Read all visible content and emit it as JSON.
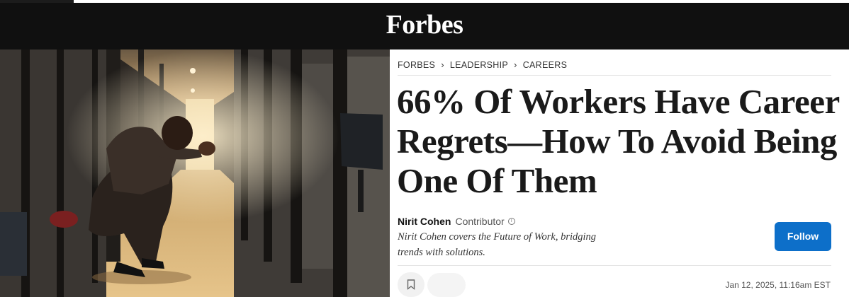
{
  "header": {
    "logo": "Forbes"
  },
  "breadcrumb": [
    "FORBES",
    "LEADERSHIP",
    "CAREERS"
  ],
  "article": {
    "headline": "66% Of Workers Have Career Regrets—How To Avoid Being One Of Them",
    "author_name": "Nirit Cohen",
    "author_role": "Contributor",
    "bio_line1": "Nirit Cohen covers the Future of Work, bridging",
    "bio_line2": "trends with solutions.",
    "follow_label": "Follow",
    "date": "Jan 12, 2025, 11:16am EST"
  },
  "icons": {
    "info": "info-icon",
    "bookmark": "bookmark-icon",
    "chevron": "chevron-right-icon"
  },
  "colors": {
    "header_bg": "#101010",
    "follow_bg": "#0d6fc9"
  }
}
